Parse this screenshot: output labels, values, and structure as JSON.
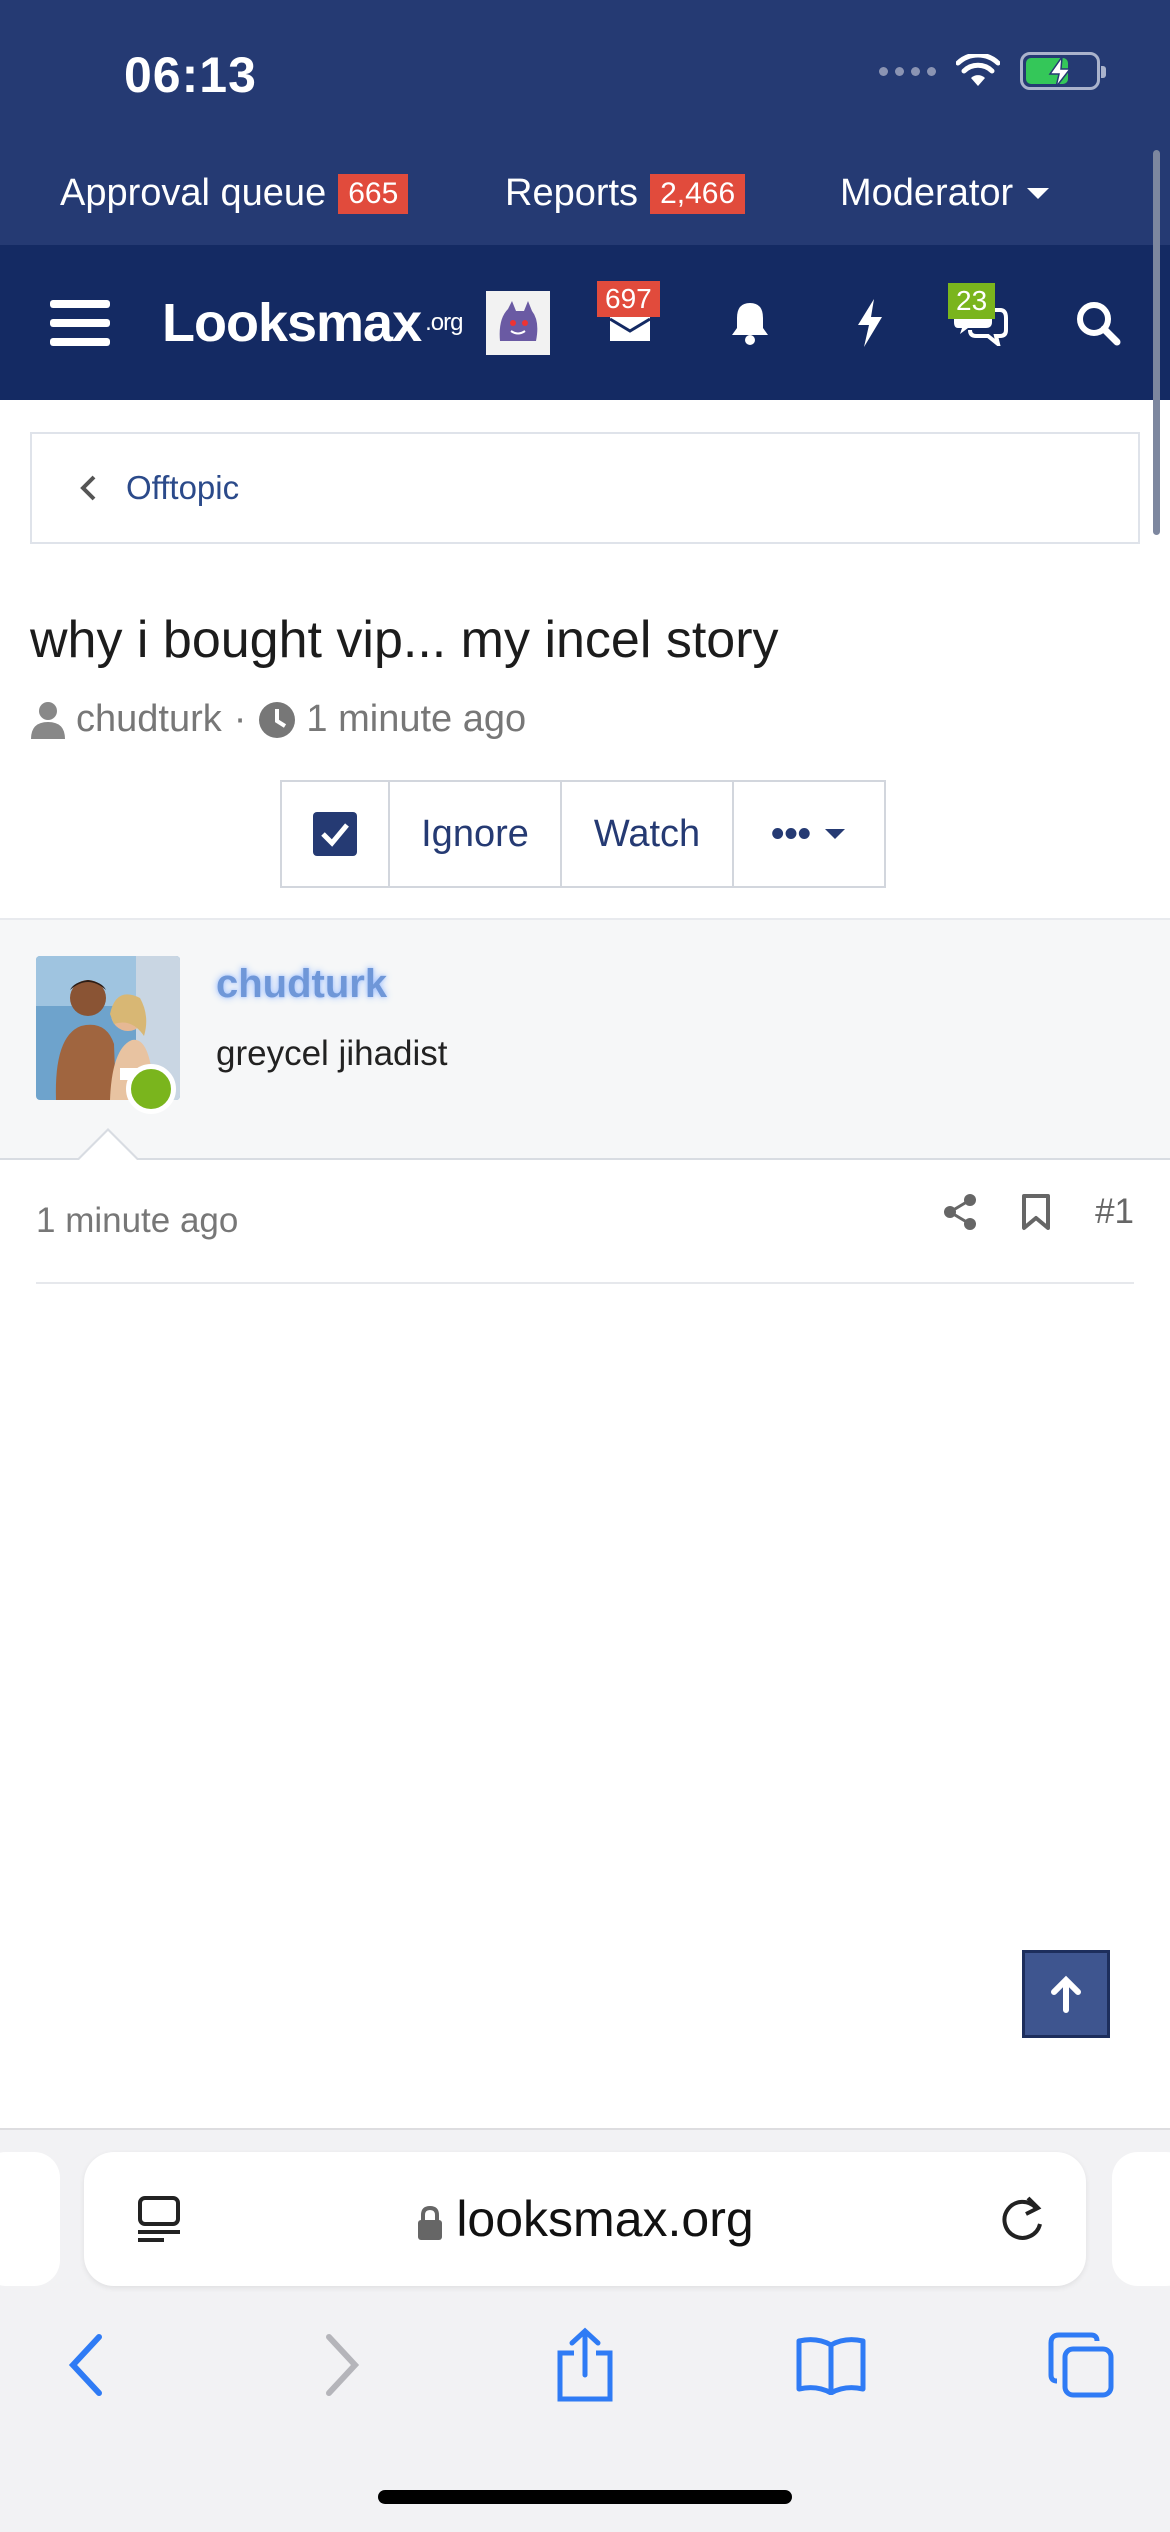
{
  "status_bar": {
    "time": "06:13"
  },
  "mod_bar": {
    "approval_label": "Approval queue",
    "approval_count": "665",
    "reports_label": "Reports",
    "reports_count": "2,466",
    "moderator_label": "Moderator"
  },
  "nav": {
    "logo_main": "Looksmax",
    "logo_suffix": ".org",
    "inbox_count": "697",
    "conversations_count": "23",
    "icons": [
      "menu-icon",
      "avatar-icon",
      "inbox-icon",
      "bell-icon",
      "bolt-icon",
      "chat-icon",
      "search-icon"
    ]
  },
  "breadcrumb": {
    "label": "Offtopic"
  },
  "thread": {
    "title": "why i bought vip... my incel story",
    "author": "chudturk",
    "time": "1 minute ago"
  },
  "actions": {
    "ignore": "Ignore",
    "watch": "Watch",
    "more": "•••"
  },
  "post": {
    "username": "chudturk",
    "user_title": "greycel jihadist",
    "time": "1 minute ago",
    "number": "#1"
  },
  "browser": {
    "url": "looksmax.org"
  },
  "colors": {
    "header": "#253a73",
    "nav": "#142a63",
    "badge_red": "#e14b3c",
    "badge_green": "#7ab51d",
    "online": "#7ab51d"
  }
}
